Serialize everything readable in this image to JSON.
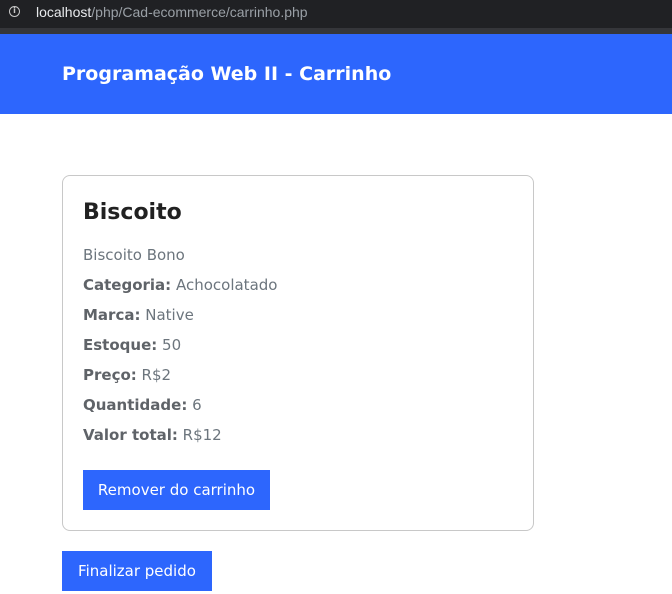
{
  "browser": {
    "url_host": "localhost",
    "url_path": "/php/Cad-ecommerce/carrinho.php"
  },
  "header": {
    "title": "Programação Web II - Carrinho"
  },
  "cart_item": {
    "name": "Biscoito",
    "description": "Biscoito Bono",
    "category_label": "Categoria:",
    "category": "Achocolatado",
    "brand_label": "Marca:",
    "brand": "Native",
    "stock_label": "Estoque:",
    "stock": "50",
    "price_label": "Preço:",
    "price": "R$2",
    "quantity_label": "Quantidade:",
    "quantity": "6",
    "total_label": "Valor total:",
    "total": "R$12",
    "remove_button": "Remover do carrinho"
  },
  "checkout_button": "Finalizar pedido",
  "colors": {
    "primary": "#2d66fd",
    "header_text": "#ffffff",
    "muted_text": "#6c757d"
  }
}
